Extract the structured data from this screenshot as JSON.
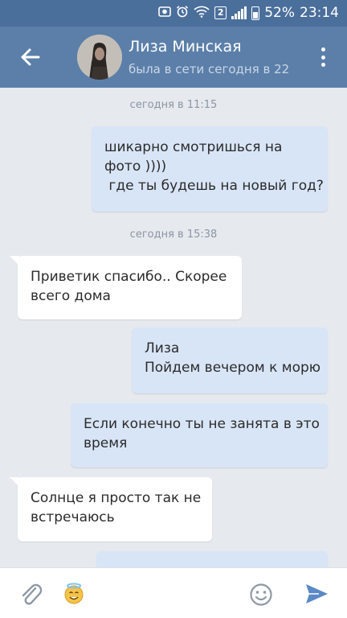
{
  "status_bar": {
    "sim_badge": "2",
    "battery": "52%",
    "time": "23:14",
    "icons": [
      "photo-icon",
      "alarm-icon",
      "wifi-icon",
      "signal-icon",
      "battery-icon"
    ]
  },
  "header": {
    "name": "Лиза Минская",
    "status": "была в сети сегодня в 22:",
    "icons": [
      "back-arrow-icon",
      "avatar",
      "more-vertical-icon"
    ]
  },
  "chat": {
    "timestamps": [
      "сегодня в 11:15",
      "сегодня в 15:38"
    ],
    "messages": [
      {
        "direction": "out",
        "lines": [
          "шикарно смотришься на",
          "фото ))))",
          " где ты будешь на новый год?"
        ]
      },
      {
        "direction": "in",
        "lines": [
          "Приветик спасибо.. Скорее",
          "всего дома"
        ]
      },
      {
        "direction": "out",
        "lines": [
          "Лиза",
          "Пойдем вечером к морю"
        ]
      },
      {
        "direction": "out",
        "lines": [
          "Если конечно ты не занята в это",
          "время"
        ]
      },
      {
        "direction": "in",
        "lines": [
          "Солнце я просто так не",
          "встречаюсь"
        ]
      }
    ]
  },
  "input_bar": {
    "icons": [
      "paperclip-icon",
      "angel-sticker-icon",
      "emoji-icon",
      "send-icon"
    ]
  },
  "colors": {
    "status_bar": "#4b6f9b",
    "header": "#5b7fa9",
    "chat_bg": "#e6e9ee",
    "bubble_out": "#d8e5f6",
    "bubble_in": "#ffffff",
    "send_accent": "#5b88c7"
  }
}
